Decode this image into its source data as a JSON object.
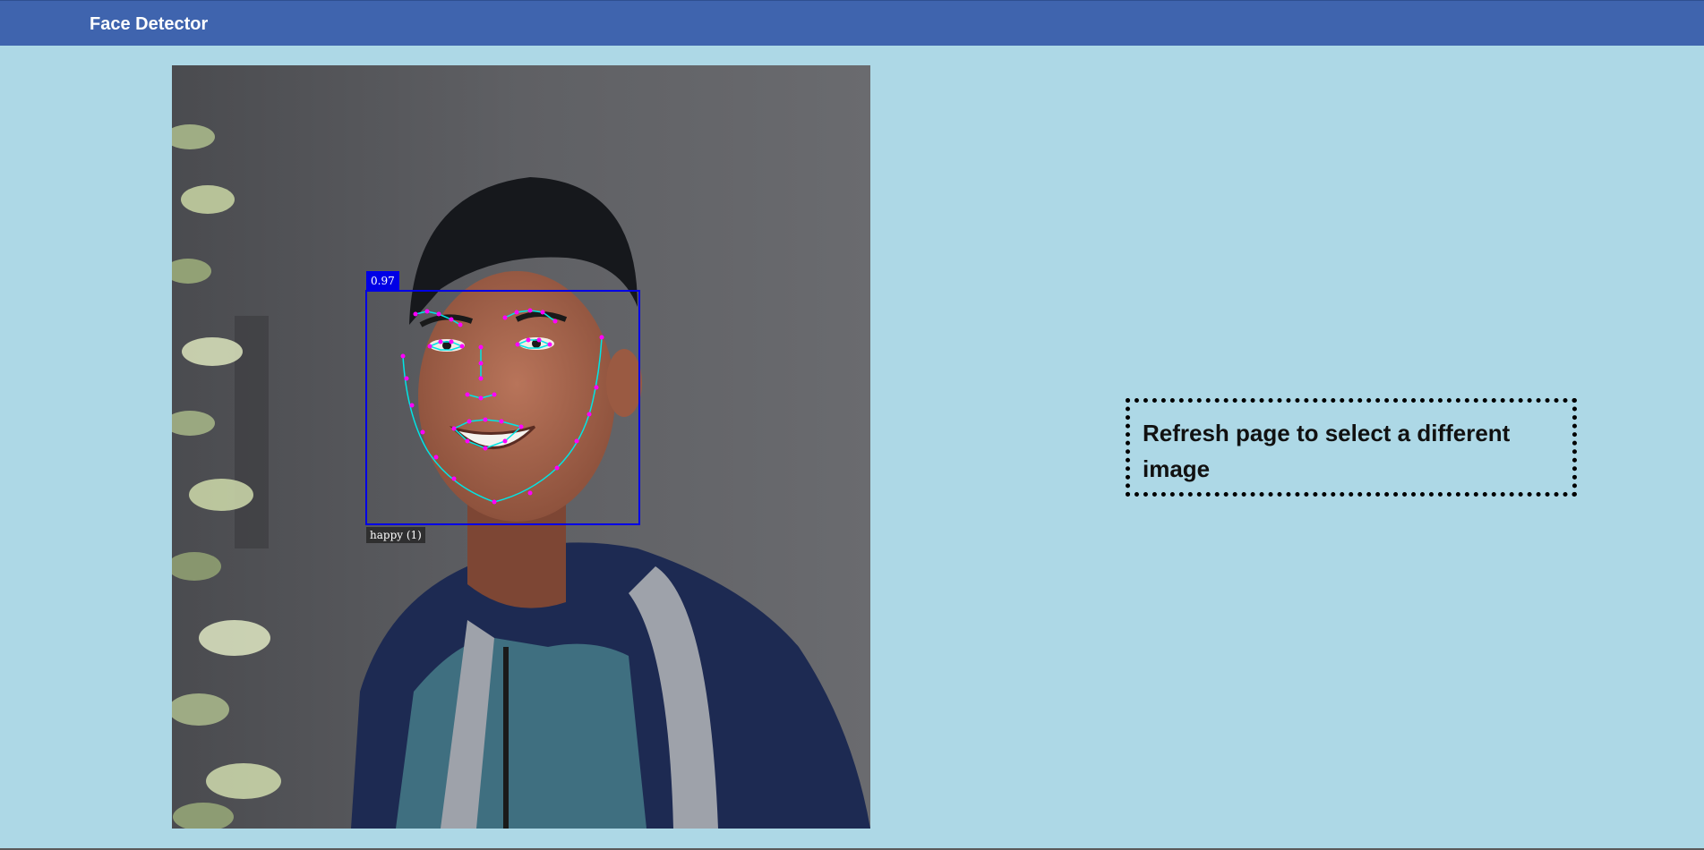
{
  "header": {
    "title": "Face Detector",
    "background": "#3f64ae"
  },
  "detection": {
    "score_label": "0.97",
    "expression_label": "happy (1)",
    "box_color": "#0000e6",
    "landmark_line_color": "#00e6e6",
    "landmark_point_color": "#ff00ff"
  },
  "notice": {
    "text": "Refresh page to select a different image"
  },
  "page": {
    "background": "#add8e6"
  }
}
